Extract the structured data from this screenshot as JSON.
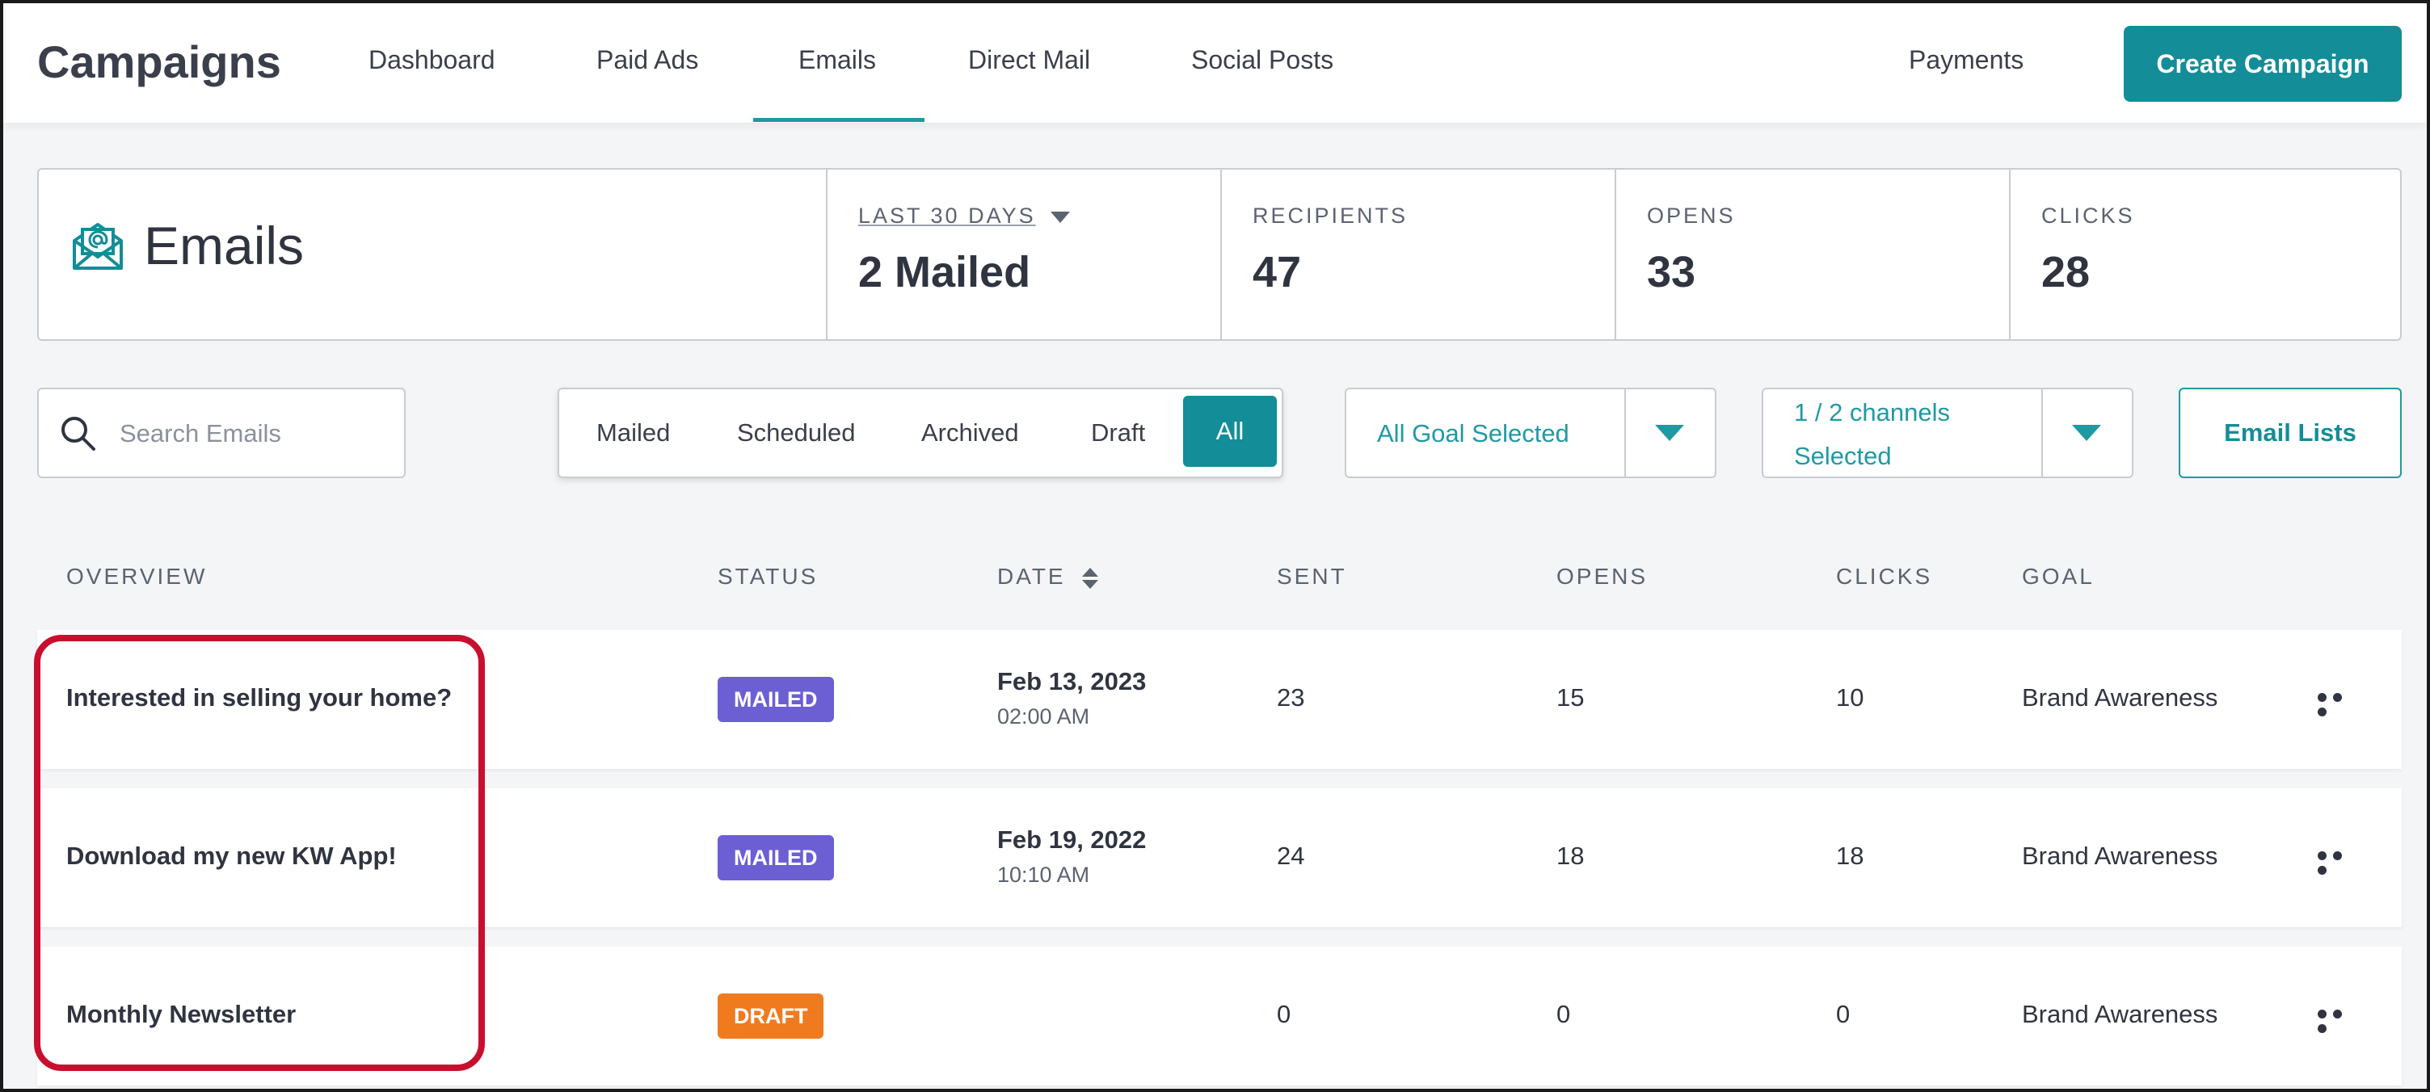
{
  "nav": {
    "brand": "Campaigns",
    "tabs": [
      "Dashboard",
      "Paid Ads",
      "Emails",
      "Direct Mail",
      "Social Posts"
    ],
    "active_tab": "Emails",
    "payments": "Payments",
    "create_button": "Create Campaign"
  },
  "stats": {
    "title": "Emails",
    "period_label": "LAST 30 DAYS",
    "mailed_value": "2 Mailed",
    "recipients_label": "RECIPIENTS",
    "recipients_value": "47",
    "opens_label": "OPENS",
    "opens_value": "33",
    "clicks_label": "CLICKS",
    "clicks_value": "28"
  },
  "filters": {
    "search_placeholder": "Search Emails",
    "segments": [
      "Mailed",
      "Scheduled",
      "Archived",
      "Draft",
      "All"
    ],
    "active_segment": "All",
    "goal_dropdown": "All Goal Selected",
    "channels_dropdown_line1": "1 / 2 channels",
    "channels_dropdown_line2": "Selected",
    "email_lists_button": "Email Lists"
  },
  "table": {
    "headers": {
      "overview": "OVERVIEW",
      "status": "STATUS",
      "date": "DATE",
      "sent": "SENT",
      "opens": "OPENS",
      "clicks": "CLICKS",
      "goal": "GOAL"
    },
    "rows": [
      {
        "overview": "Interested in selling your home?",
        "status": "MAILED",
        "date": "Feb 13, 2023",
        "time": "02:00 AM",
        "sent": "23",
        "opens": "15",
        "clicks": "10",
        "goal": "Brand Awareness"
      },
      {
        "overview": "Download my new KW App!",
        "status": "MAILED",
        "date": "Feb 19, 2022",
        "time": "10:10 AM",
        "sent": "24",
        "opens": "18",
        "clicks": "18",
        "goal": "Brand Awareness"
      },
      {
        "overview": "Monthly Newsletter",
        "status": "DRAFT",
        "date": "",
        "time": "",
        "sent": "0",
        "opens": "0",
        "clicks": "0",
        "goal": "Brand Awareness"
      }
    ]
  },
  "colors": {
    "accent": "#138d97",
    "mailed_badge": "#6b5fd3",
    "draft_badge": "#f07b1f",
    "highlight": "#c8102e"
  },
  "icons": {
    "email": "envelope-at-icon",
    "search": "search-icon",
    "more": "more-horizontal-icon",
    "sort": "sort-icon"
  }
}
